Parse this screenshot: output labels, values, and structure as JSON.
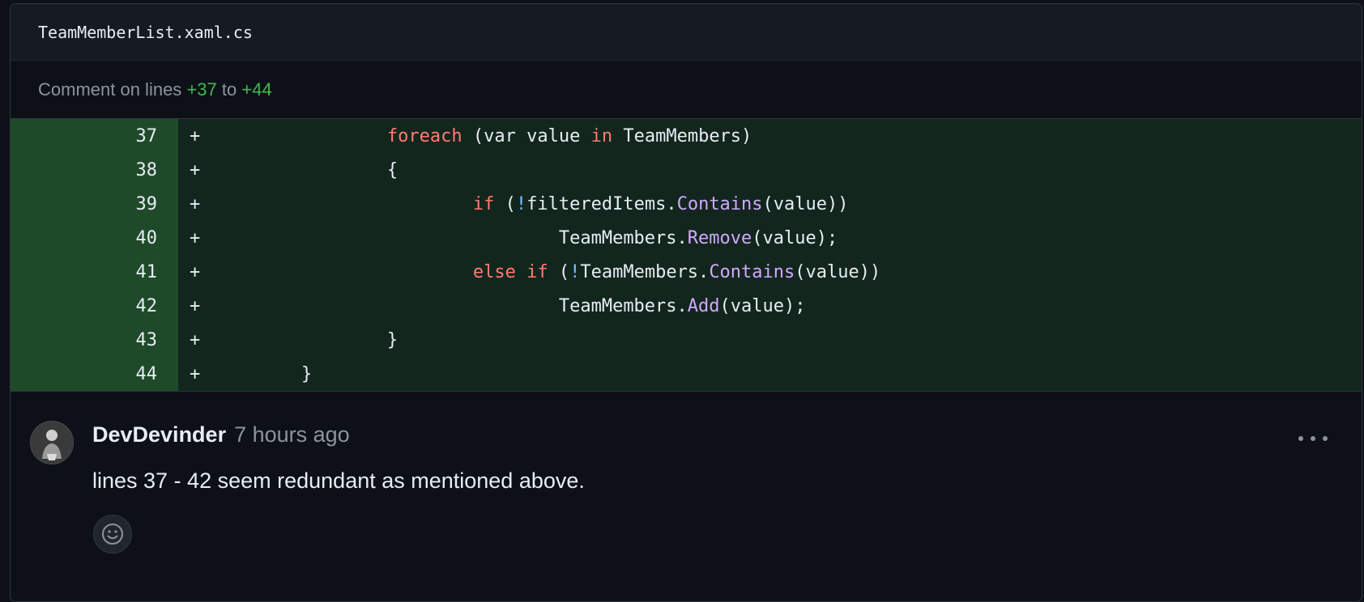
{
  "file": {
    "name": "TeamMemberList.xaml.cs"
  },
  "comment_range": {
    "prefix": "Comment on lines",
    "start": "+37",
    "to": "to",
    "end": "+44"
  },
  "diff": {
    "marker": "+",
    "lines": [
      {
        "number": "37",
        "indent": "                ",
        "tokens": [
          {
            "t": "foreach",
            "c": "kw"
          },
          {
            "t": " (",
            "c": ""
          },
          {
            "t": "var",
            "c": ""
          },
          {
            "t": " value ",
            "c": ""
          },
          {
            "t": "in",
            "c": "kw"
          },
          {
            "t": " TeamMembers)",
            "c": ""
          }
        ]
      },
      {
        "number": "38",
        "indent": "                ",
        "tokens": [
          {
            "t": "{",
            "c": ""
          }
        ]
      },
      {
        "number": "39",
        "indent": "                        ",
        "tokens": [
          {
            "t": "if",
            "c": "kw"
          },
          {
            "t": " (",
            "c": ""
          },
          {
            "t": "!",
            "c": "op"
          },
          {
            "t": "filteredItems.",
            "c": ""
          },
          {
            "t": "Contains",
            "c": "fn"
          },
          {
            "t": "(value))",
            "c": ""
          }
        ]
      },
      {
        "number": "40",
        "indent": "                                ",
        "tokens": [
          {
            "t": "TeamMembers.",
            "c": ""
          },
          {
            "t": "Remove",
            "c": "fn"
          },
          {
            "t": "(value);",
            "c": ""
          }
        ]
      },
      {
        "number": "41",
        "indent": "                        ",
        "tokens": [
          {
            "t": "else if",
            "c": "kw"
          },
          {
            "t": " (",
            "c": ""
          },
          {
            "t": "!",
            "c": "op"
          },
          {
            "t": "TeamMembers.",
            "c": ""
          },
          {
            "t": "Contains",
            "c": "fn"
          },
          {
            "t": "(value))",
            "c": ""
          }
        ]
      },
      {
        "number": "42",
        "indent": "                                ",
        "tokens": [
          {
            "t": "TeamMembers.",
            "c": ""
          },
          {
            "t": "Add",
            "c": "fn"
          },
          {
            "t": "(value);",
            "c": ""
          }
        ]
      },
      {
        "number": "43",
        "indent": "                ",
        "tokens": [
          {
            "t": "}",
            "c": ""
          }
        ]
      },
      {
        "number": "44",
        "indent": "        ",
        "tokens": [
          {
            "t": "}",
            "c": ""
          }
        ]
      }
    ]
  },
  "comment": {
    "author": "DevDevinder",
    "time": "7 hours ago",
    "body": "lines 37 - 42 seem redundant as mentioned above.",
    "avatar_icon": "user-avatar",
    "menu_icon": "kebab-horizontal-icon",
    "reaction_icon": "smiley-icon"
  },
  "colors": {
    "background": "#0d1117",
    "added_line_bg": "#12261e",
    "added_number_bg": "#1f4a2a",
    "keyword": "#ff7b72",
    "function": "#d2a8ff",
    "muted": "#8b949e",
    "added_text": "#3fb950"
  }
}
